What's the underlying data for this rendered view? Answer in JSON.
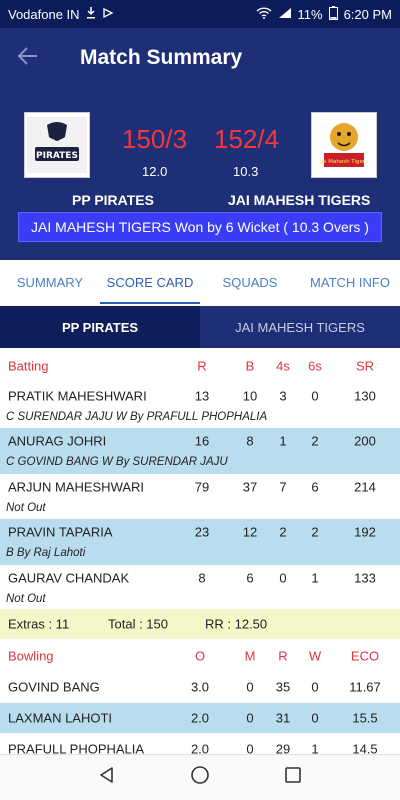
{
  "status_bar": {
    "carrier": "Vodafone IN",
    "battery": "11%",
    "time": "6:20 PM",
    "icons": [
      "download-icon",
      "nfc-icon",
      "wifi-icon",
      "signal-icon",
      "battery-icon"
    ]
  },
  "app_bar": {
    "title": "Match Summary",
    "back_icon": "arrow-left-icon"
  },
  "match": {
    "team1": {
      "name": "PP PIRATES",
      "score": "150/3",
      "overs": "12.0",
      "logo_text": "PIRATES"
    },
    "team2": {
      "name": "JAI MAHESH TIGERS",
      "score": "152/4",
      "overs": "10.3",
      "logo_text": "Jai Mahesh Tigers"
    },
    "result": "JAI MAHESH TIGERS Won by 6 Wicket ( 10.3 Overs )"
  },
  "tabs": [
    "SUMMARY",
    "SCORE CARD",
    "SQUADS",
    "MATCH INFO"
  ],
  "active_tab": "SCORE CARD",
  "team_tabs": [
    "PP PIRATES",
    "JAI MAHESH TIGERS"
  ],
  "batting": {
    "headers": [
      "Batting",
      "R",
      "B",
      "4s",
      "6s",
      "SR"
    ],
    "rows": [
      {
        "name": "PRATIK MAHESHWARI",
        "r": "13",
        "b": "10",
        "fours": "3",
        "sixes": "0",
        "sr": "130",
        "dismissal": "C SURENDAR JAJU W By PRAFULL PHOPHALIA"
      },
      {
        "name": "ANURAG JOHRI",
        "r": "16",
        "b": "8",
        "fours": "1",
        "sixes": "2",
        "sr": "200",
        "dismissal": "C GOVIND BANG W By SURENDAR JAJU"
      },
      {
        "name": "ARJUN MAHESHWARI",
        "r": "79",
        "b": "37",
        "fours": "7",
        "sixes": "6",
        "sr": "214",
        "dismissal": "Not Out"
      },
      {
        "name": "PRAVIN TAPARIA",
        "r": "23",
        "b": "12",
        "fours": "2",
        "sixes": "2",
        "sr": "192",
        "dismissal": "B By Raj Lahoti"
      },
      {
        "name": "GAURAV CHANDAK",
        "r": "8",
        "b": "6",
        "fours": "0",
        "sixes": "1",
        "sr": "133",
        "dismissal": "Not Out"
      }
    ]
  },
  "extras": {
    "extras": "Extras : 11",
    "total": "Total : 150",
    "rr": "RR : 12.50"
  },
  "bowling": {
    "headers": [
      "Bowling",
      "O",
      "M",
      "R",
      "W",
      "ECO"
    ],
    "rows": [
      {
        "name": "GOVIND BANG",
        "o": "3.0",
        "m": "0",
        "r": "35",
        "w": "0",
        "eco": "11.67"
      },
      {
        "name": "LAXMAN LAHOTI",
        "o": "2.0",
        "m": "0",
        "r": "31",
        "w": "0",
        "eco": "15.5"
      },
      {
        "name": "PRAFULL PHOPHALIA",
        "o": "2.0",
        "m": "0",
        "r": "29",
        "w": "1",
        "eco": "14.5"
      }
    ]
  },
  "nav": [
    "back-triangle-icon",
    "home-circle-icon",
    "recents-square-icon"
  ],
  "colors": {
    "primary": "#1e2f78",
    "status_bar": "#0c1c5a",
    "score_red": "#f0383f",
    "result_banner": "#3a3df5",
    "row_blue": "#b9dcef",
    "extras_yellow": "#f4f7c8",
    "header_red": "#e0353a",
    "tab_blue": "#2a5fb8"
  }
}
